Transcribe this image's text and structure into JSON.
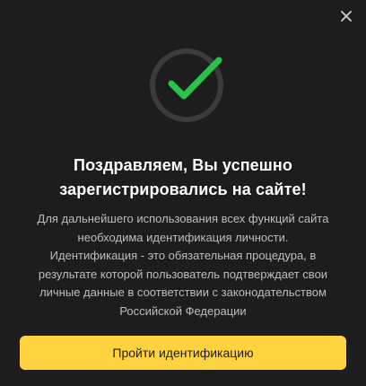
{
  "dialog": {
    "close_icon": "close-icon",
    "status_icon": "checkmark-success-icon",
    "accent_color": "#ffd33f",
    "success_color": "#2bc24a",
    "title_lines": [
      "Поздравляем, Вы успешно",
      "зарегистрировались на сайте!"
    ],
    "description_lines": [
      "Для дальнейшего использования всех функций сайта",
      "необходима идентификация личности.",
      "Идентификация - это обязательная процедура, в",
      "результате которой пользователь подтверждает свои",
      "личные данные в соответствии с законодательством",
      "Российской Федерации"
    ],
    "button_label": "Пройти идентификацию"
  }
}
